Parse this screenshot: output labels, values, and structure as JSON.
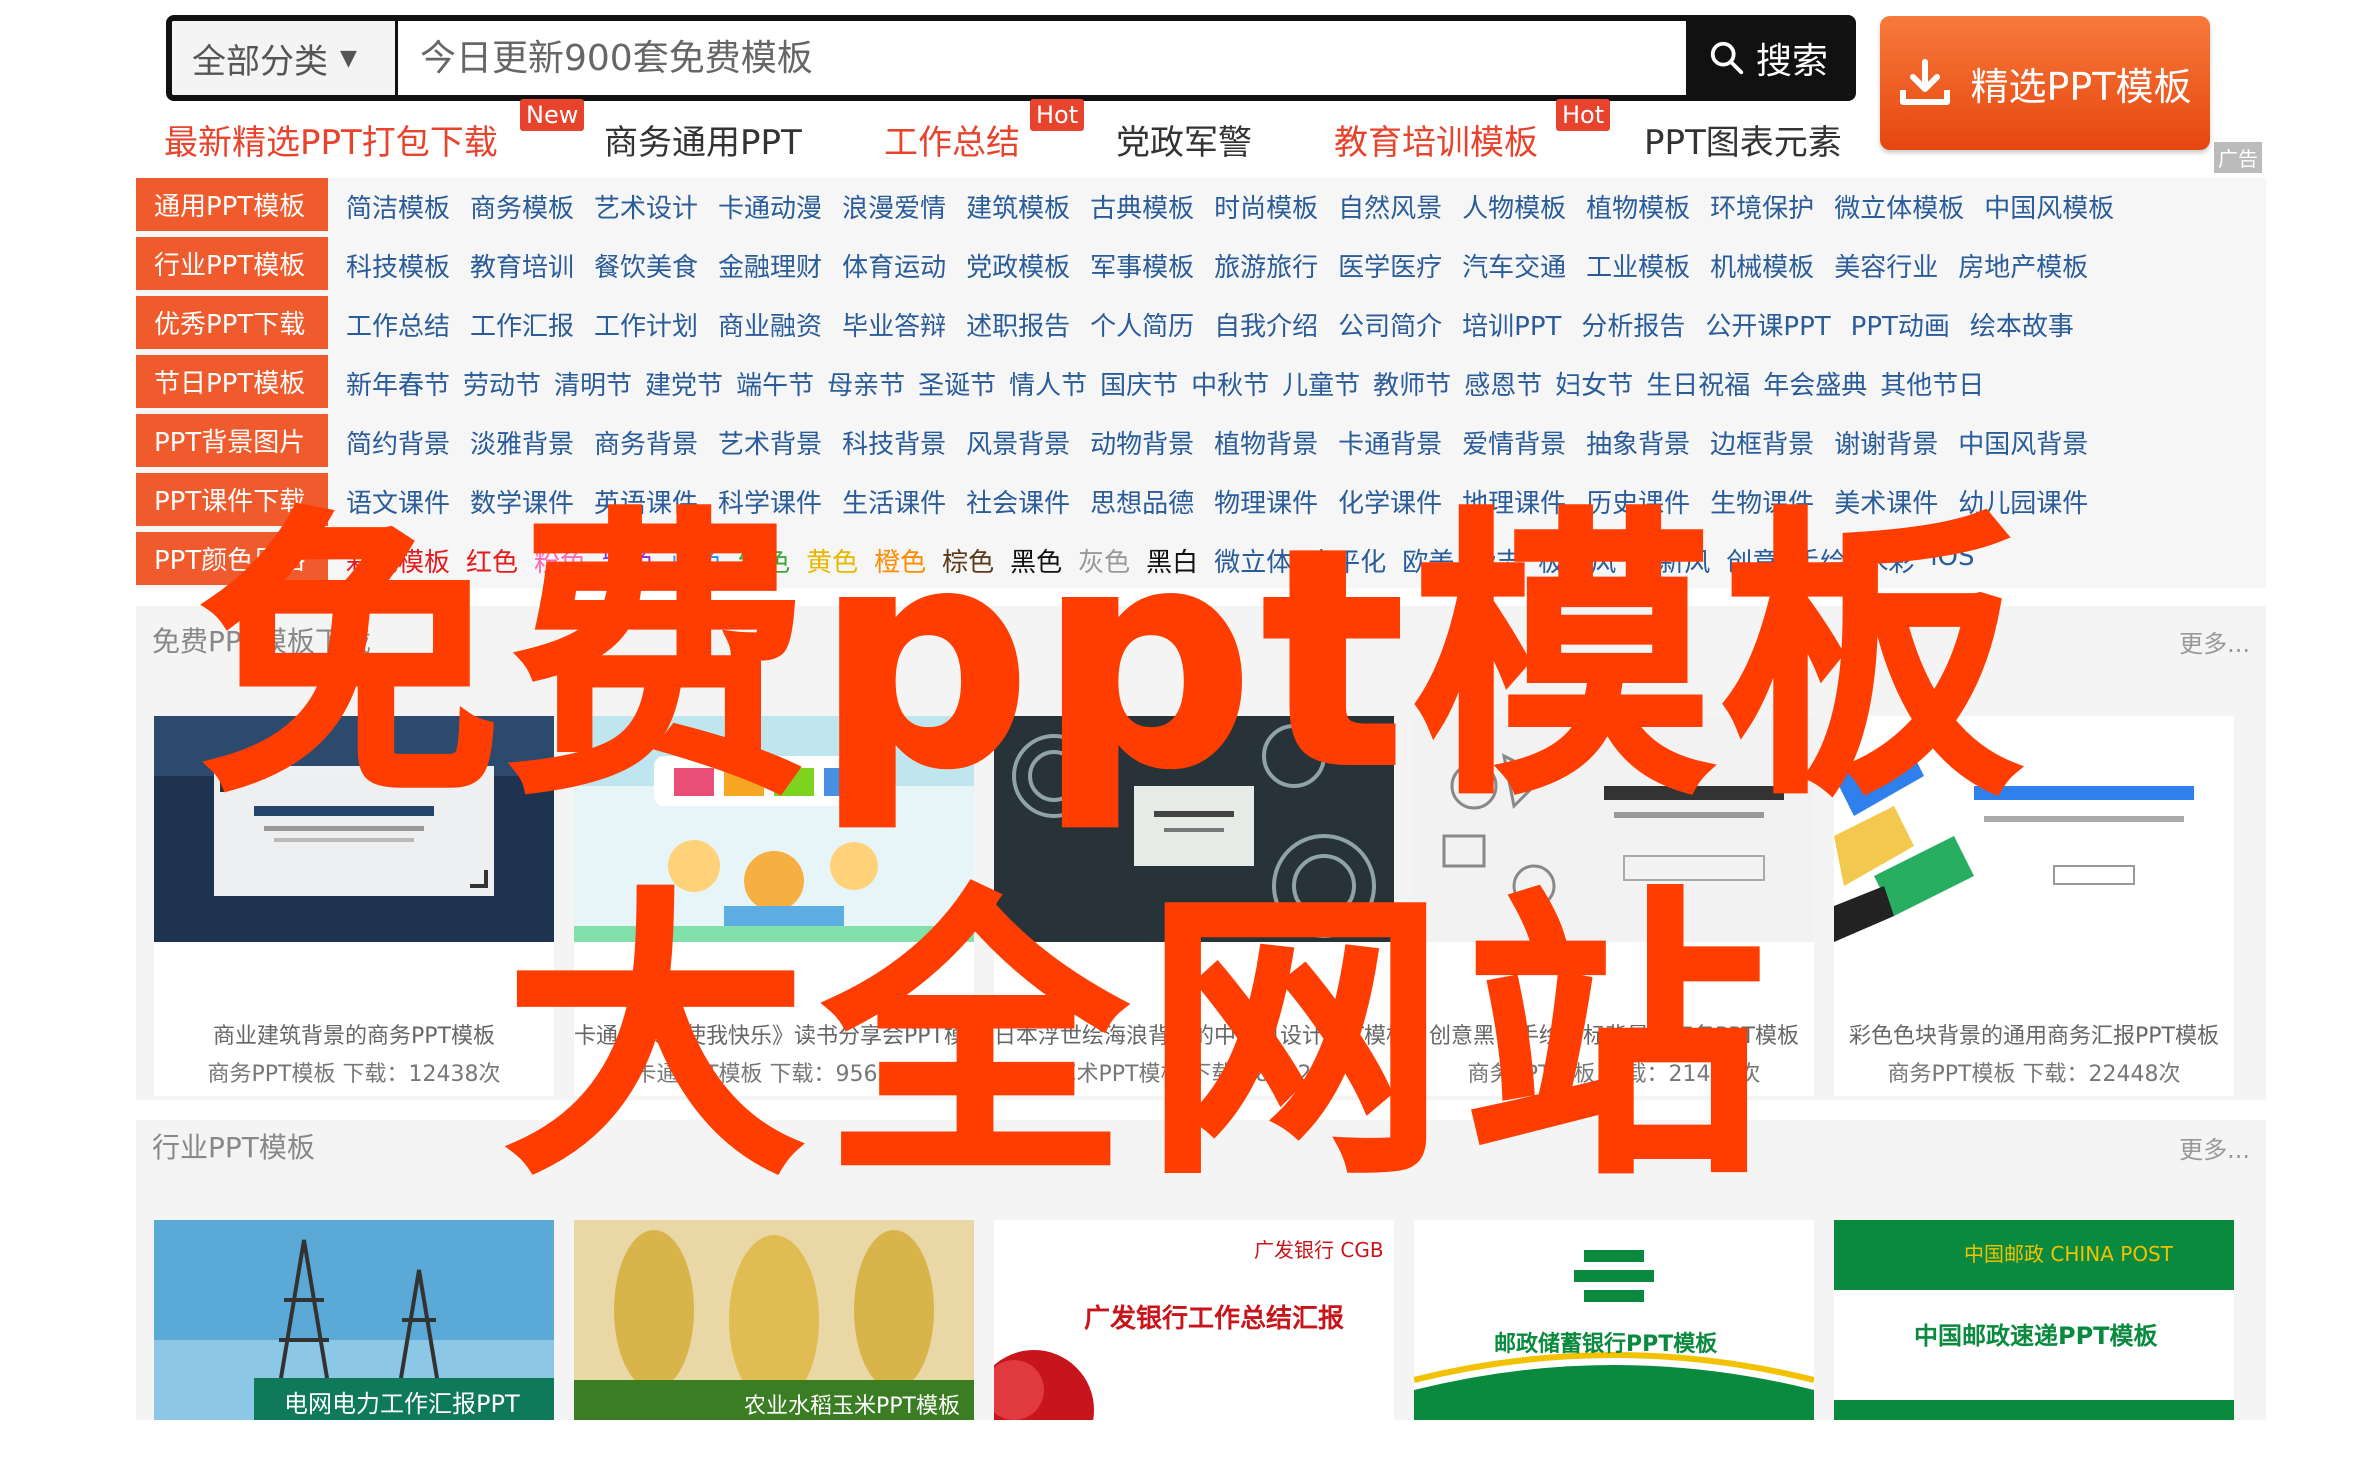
{
  "search": {
    "category_label": "全部分类",
    "placeholder": "今日更新900套免费模板",
    "button_label": "搜索"
  },
  "cta": {
    "label": "精选PPT模板",
    "ad_label": "广告"
  },
  "hot_links": [
    {
      "label": "最新精选PPT打包下载",
      "badge": "New"
    },
    {
      "label": "商务通用PPT",
      "badge": ""
    },
    {
      "label": "工作总结",
      "badge": "Hot"
    },
    {
      "label": "党政军警",
      "badge": ""
    },
    {
      "label": "教育培训模板",
      "badge": "Hot"
    },
    {
      "label": "PPT图表元素",
      "badge": ""
    }
  ],
  "nav_rows": [
    {
      "head": "通用PPT模板",
      "links": [
        "简洁模板",
        "商务模板",
        "艺术设计",
        "卡通动漫",
        "浪漫爱情",
        "建筑模板",
        "古典模板",
        "时尚模板",
        "自然风景",
        "人物模板",
        "植物模板",
        "环境保护",
        "微立体模板",
        "中国风模板"
      ]
    },
    {
      "head": "行业PPT模板",
      "links": [
        "科技模板",
        "教育培训",
        "餐饮美食",
        "金融理财",
        "体育运动",
        "党政模板",
        "军事模板",
        "旅游旅行",
        "医学医疗",
        "汽车交通",
        "工业模板",
        "机械模板",
        "美容行业",
        "房地产模板"
      ]
    },
    {
      "head": "优秀PPT下载",
      "links": [
        "工作总结",
        "工作汇报",
        "工作计划",
        "商业融资",
        "毕业答辩",
        "述职报告",
        "个人简历",
        "自我介绍",
        "公司简介",
        "培训PPT",
        "分析报告",
        "公开课PPT",
        "PPT动画",
        "绘本故事"
      ]
    },
    {
      "head": "节日PPT模板",
      "links": [
        "新年春节",
        "劳动节",
        "清明节",
        "建党节",
        "端午节",
        "母亲节",
        "圣诞节",
        "情人节",
        "国庆节",
        "中秋节",
        "儿童节",
        "教师节",
        "感恩节",
        "妇女节",
        "生日祝福",
        "年会盛典",
        "其他节日"
      ]
    },
    {
      "head": "PPT背景图片",
      "links": [
        "简约背景",
        "淡雅背景",
        "商务背景",
        "艺术背景",
        "科技背景",
        "风景背景",
        "动物背景",
        "植物背景",
        "卡通背景",
        "爱情背景",
        "抽象背景",
        "边框背景",
        "谢谢背景",
        "中国风背景"
      ]
    },
    {
      "head": "PPT课件下载",
      "links": [
        "语文课件",
        "数学课件",
        "英语课件",
        "科学课件",
        "生活课件",
        "社会课件",
        "思想品德",
        "物理课件",
        "化学课件",
        "地理课件",
        "历史课件",
        "生物课件",
        "美术课件",
        "幼儿园课件"
      ]
    },
    {
      "head": "PPT颜色风格",
      "links": [
        "彩色模板",
        "红色",
        "粉色",
        "紫色",
        "蓝色",
        "绿色",
        "黄色",
        "橙色",
        "棕色",
        "黑色",
        "灰色",
        "黑白",
        "微立体",
        "扁平化",
        "欧美",
        "杂志",
        "极简风",
        "清新风",
        "创意",
        "手绘",
        "水彩",
        "iOS"
      ]
    }
  ],
  "sections": [
    {
      "title": "免费PPT模板下载",
      "more": "更多...",
      "cards": [
        {
          "title": "商业建筑背景的商务PPT模板",
          "meta": "商务PPT模板  下载：12438次"
        },
        {
          "title": "卡通《读书使我快乐》读书分享会PPT模板",
          "meta": "卡通PPT模板  下载：9563次"
        },
        {
          "title": "日本浮世绘海浪背景的中国风设计PPT模板",
          "meta": "艺术PPT模板  下载：8832次"
        },
        {
          "title": "创意黑白手绘图标背景的商务PPT模板",
          "meta": "商务PPT模板  下载：21496次"
        },
        {
          "title": "彩色色块背景的通用商务汇报PPT模板",
          "meta": "商务PPT模板  下载：22448次"
        }
      ]
    },
    {
      "title": "行业PPT模板",
      "more": "更多...",
      "cards": [
        {
          "caption": "电网电力工作汇报PPT"
        },
        {
          "caption": "农业水稻玉米PPT模板"
        },
        {
          "caption": "广发银行工作总结汇报",
          "logo": "广发银行 CGB"
        },
        {
          "caption": "邮政储蓄银行PPT模板"
        },
        {
          "caption": "中国邮政速递PPT模板",
          "logo": "中国邮政 CHINA POST"
        }
      ]
    }
  ],
  "overlay": {
    "line1": "免费ppt模板",
    "line2": "大全网站"
  },
  "colors": {
    "accent": "#f05b2e",
    "overlay": "#ff3d00",
    "link": "#2a5c9a"
  }
}
